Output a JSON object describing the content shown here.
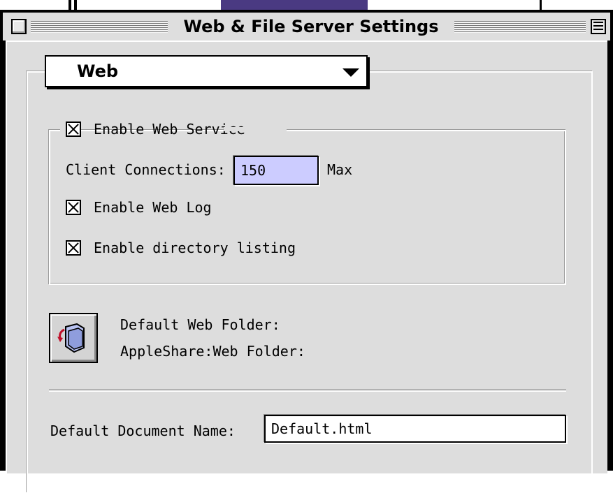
{
  "window": {
    "title": "Web & File Server Settings"
  },
  "panel_selector": {
    "selected": "Web"
  },
  "web_service": {
    "enable_label": "Enable Web Service",
    "enabled": true,
    "client_connections_label": "Client Connections:",
    "client_connections_value": "150",
    "client_connections_suffix": "Max",
    "web_log_label": "Enable Web Log",
    "web_log_enabled": true,
    "directory_listing_label": "Enable directory listing",
    "directory_listing_enabled": true
  },
  "folder": {
    "label": "Default Web Folder:",
    "path": "AppleShare:Web Folder:",
    "icon": "folder-arrow-icon"
  },
  "document": {
    "label": "Default Document Name:",
    "value": "Default.html"
  },
  "colors": {
    "window_bg": "#dddddd",
    "active_field": "#ccccff",
    "background_app_accent": "#4a3a82"
  }
}
